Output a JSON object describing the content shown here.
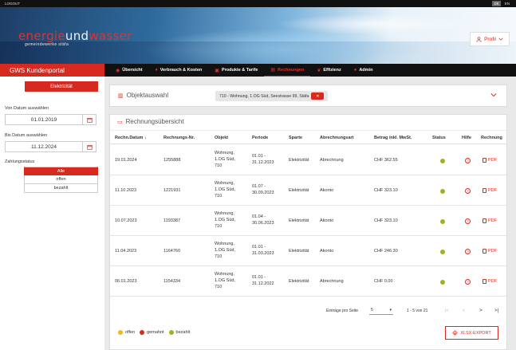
{
  "topbar": {
    "logout": "LOGOUT",
    "lang_de": "DE",
    "lang_en": "EN"
  },
  "logo": {
    "part1": "energie",
    "part2": "und",
    "part3": "wasser",
    "subtitle": "gemeindewerke stäfa"
  },
  "profile": {
    "label": "Profil"
  },
  "nav": {
    "brand": "GWS Kundenportal",
    "items": [
      {
        "label": "Übersicht",
        "icon": "gauge-icon"
      },
      {
        "label": "Verbrauch & Kosten",
        "icon": "pin-icon"
      },
      {
        "label": "Produkte & Tarife",
        "icon": "gift-icon"
      },
      {
        "label": "Rechnungen",
        "icon": "invoice-icon",
        "active": true
      },
      {
        "label": "Effizienz",
        "icon": "leaf-icon"
      },
      {
        "label": "Admin",
        "icon": "user-icon"
      }
    ]
  },
  "sidebar": {
    "product_button": "Elektrizität",
    "from_label": "Von Datum auswählen",
    "from_value": "01.01.2019",
    "to_label": "Bis Datum auswählen",
    "to_value": "11.12.2024",
    "status_label": "Zahlungsstatus",
    "status_options": [
      "Alle",
      "offen",
      "bezahlt"
    ]
  },
  "object": {
    "title": "Objektauswahl",
    "selected": "710 - Wohnung, 1.OG Süd, Seestrasse 99, Stäfa"
  },
  "invoices": {
    "title": "Rechnungsübersicht",
    "headers": [
      "Rechn.Datum",
      "Rechnungs-Nr.",
      "Objekt",
      "Periode",
      "Sparte",
      "Abrechnungsart",
      "Betrag inkl. MwSt.",
      "Status",
      "Hilfe",
      "Rechnung"
    ],
    "sort_arrow": "↓",
    "rows": [
      {
        "date": "19.01.2024",
        "number": "1255888",
        "object": [
          "Wohnung,",
          "1.OG Süd,",
          "710"
        ],
        "period": [
          "01.01 -",
          "31.12.2023"
        ],
        "sparte": "Elektrizität",
        "art": "Abrechnung",
        "amount": "CHF 362.55",
        "status_color": "#9bb522",
        "help": "?",
        "pdf": "PDF"
      },
      {
        "date": "11.10.2023",
        "number": "1221931",
        "object": [
          "Wohnung,",
          "1.OG Süd,",
          "710"
        ],
        "period": [
          "01.07 -",
          "30.09.2023"
        ],
        "sparte": "Elektrizität",
        "art": "Akonto",
        "amount": "CHF 323.10",
        "status_color": "#9bb522",
        "help": "?",
        "pdf": "PDF"
      },
      {
        "date": "10.07.2023",
        "number": "1193387",
        "object": [
          "Wohnung,",
          "1.OG Süd,",
          "710"
        ],
        "period": [
          "01.04 -",
          "30.06.2023"
        ],
        "sparte": "Elektrizität",
        "art": "Akonto",
        "amount": "CHF 323.10",
        "status_color": "#9bb522",
        "help": "?",
        "pdf": "PDF"
      },
      {
        "date": "11.04.2023",
        "number": "1164760",
        "object": [
          "Wohnung,",
          "1.OG Süd,",
          "710"
        ],
        "period": [
          "01.01 -",
          "31.03.2023"
        ],
        "sparte": "Elektrizität",
        "art": "Akonto",
        "amount": "CHF 246.30",
        "status_color": "#9bb522",
        "help": "?",
        "pdf": "PDF"
      },
      {
        "date": "06.01.2023",
        "number": "1154334",
        "object": [
          "Wohnung,",
          "1.OG Süd,",
          "710"
        ],
        "period": [
          "01.01 -",
          "31.12.2022"
        ],
        "sparte": "Elektrizität",
        "art": "Abrechnung",
        "amount": "CHF 0.00",
        "status_color": "#9bb522",
        "help": "?",
        "pdf": "PDF"
      }
    ],
    "pager": {
      "per_page_label": "Einträge pro Seite",
      "per_page": "5",
      "range": "1 - 5 von 21",
      "first": "|<",
      "prev": "<",
      "next": ">",
      "last": ">|"
    },
    "legend": [
      {
        "label": "offen",
        "color": "#f0b81c"
      },
      {
        "label": "gemahnt",
        "color": "#d62a21"
      },
      {
        "label": "bezahlt",
        "color": "#9bb522"
      }
    ],
    "export": "XLSX-EXPORT"
  }
}
